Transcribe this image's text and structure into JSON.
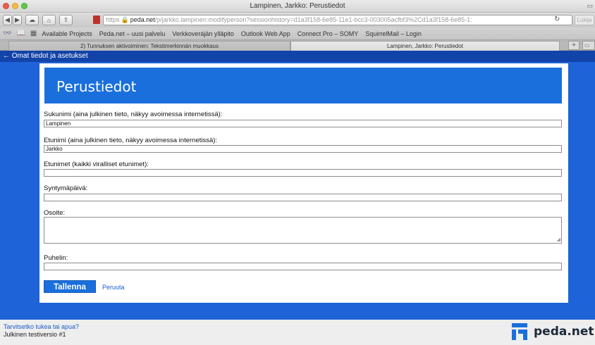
{
  "browser": {
    "window_title": "Lampinen, Jarkko: Perustiedot",
    "url_scheme": "https",
    "url_host": "peda.net",
    "url_path": "/p/jarkko.lampinen:modifyperson?sessionhistory=d1a3f158-6e85-11e1-bcc3-003005acfbf3%2Cd1a3f158-6e85-1:",
    "reader_label": "Lukija",
    "bookmarks": [
      "Available Projects",
      "Peda.net – uusi palvelu",
      "Verkkoverájän ylläpito",
      "Outlook Web App",
      "Connect Pro – SOMY",
      "SquirrelMail – Login"
    ],
    "tabs": [
      "2) Tunnuksen aktivoiminen: Tekstimerkinnän muokkaus",
      "Lampinen, Jarkko: Perustiedot"
    ]
  },
  "nav": {
    "back_link": "← Omat tiedot ja asetukset"
  },
  "form": {
    "heading": "Perustiedot",
    "fields": [
      {
        "label": "Sukunimi (aina julkinen tieto, näkyy avoimessa internetissä):",
        "value": "Lampinen"
      },
      {
        "label": "Etunimi (aina julkinen tieto, näkyy avoimessa internetissä):",
        "value": "Jarkko"
      },
      {
        "label": "Etunimet (kaikki viralliset etunimet):",
        "value": ""
      },
      {
        "label": "Syntymäpäivä:",
        "value": ""
      },
      {
        "label": "Osoite:",
        "value": ""
      },
      {
        "label": "Puhelin:",
        "value": ""
      }
    ],
    "save_label": "Tallenna",
    "cancel_label": "Peruuta"
  },
  "footer": {
    "help_link": "Tarvitsetko tukea tai apua?",
    "version": "Julkinen testiversio #1",
    "logo_text": "peda.net"
  },
  "colors": {
    "page_bg": "#1e63d8",
    "header_bar": "#1a6fdc",
    "nav_bar": "#1243a8"
  }
}
